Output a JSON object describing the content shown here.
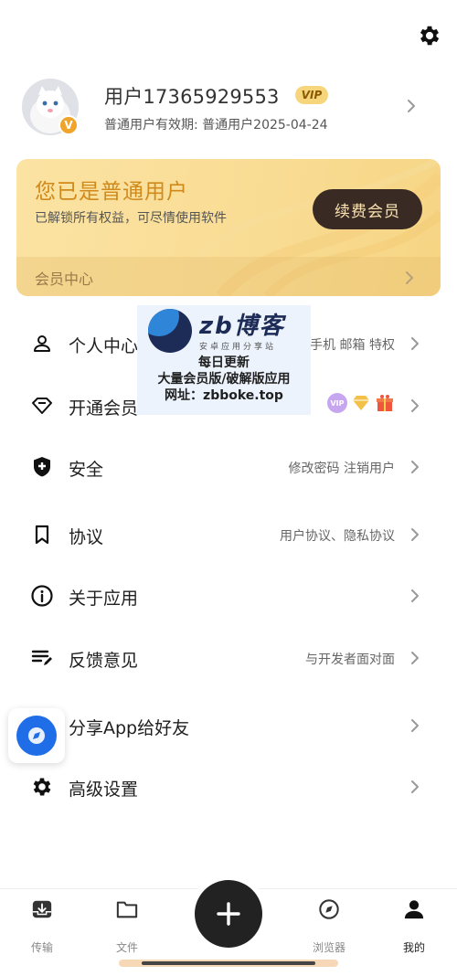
{
  "settings": {
    "icon": "gear-icon"
  },
  "profile": {
    "username": "用户17365929553",
    "vip_tag": "VIP",
    "avatar_badge": "V",
    "validity": "普通用户有效期:  普通用户2025-04-24"
  },
  "vip_card": {
    "title": "您已是普通用户",
    "subtitle": "已解锁所有权益，可尽情使用软件",
    "renew_button": "续费会员",
    "center_label": "会员中心",
    "title_color": "#d08a1c"
  },
  "menu": {
    "items": [
      {
        "label": "个人中心",
        "extra": "手机 邮箱 特权",
        "icon": "person-icon"
      },
      {
        "label": "开通会员",
        "extra": "",
        "icon": "diamond-icon",
        "badges": [
          "VIP",
          "diamond",
          "gift"
        ]
      },
      {
        "label": "安全",
        "extra": "修改密码  注销用户",
        "icon": "shield-icon"
      },
      {
        "label": "协议",
        "extra": "用户协议、隐私协议",
        "icon": "bookmark-icon"
      },
      {
        "label": "关于应用",
        "extra": "",
        "icon": "info-icon"
      },
      {
        "label": "反馈意见",
        "extra": "与开发者面对面",
        "icon": "feedback-icon"
      },
      {
        "label": "分享App给好友",
        "extra": "",
        "icon": "share-icon"
      },
      {
        "label": "高级设置",
        "extra": "",
        "icon": "gear-icon"
      }
    ]
  },
  "watermark": {
    "brand": "zb博客",
    "brand_sub": "安卓应用分享站",
    "line1": "每日更新",
    "line2": "大量会员版/破解版应用",
    "line3": "网址：zbboke.top"
  },
  "tabbar": {
    "tabs": [
      {
        "label": "传输",
        "icon": "download-tray-icon"
      },
      {
        "label": "文件",
        "icon": "folder-icon"
      },
      {
        "label": "浏览器",
        "icon": "compass-icon"
      },
      {
        "label": "我的",
        "icon": "user-icon",
        "active": true
      }
    ],
    "fab_icon": "plus-icon"
  }
}
